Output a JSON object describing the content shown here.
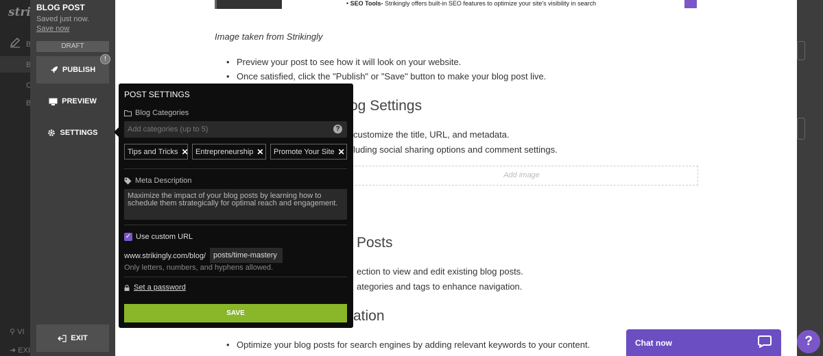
{
  "app": {
    "logo_text": "strik",
    "bg_letters": [
      "B",
      "B",
      "C",
      "B",
      "E"
    ],
    "bg_bottom": [
      "VI",
      "EXI"
    ]
  },
  "editor_sidebar": {
    "title": "BLOG POST",
    "saved_status": "Saved just now.",
    "save_now": "Save now",
    "draft_label": "DRAFT",
    "publish_label": "PUBLISH",
    "publish_badge": "!",
    "preview_label": "PREVIEW",
    "settings_label": "SETTINGS",
    "exit_label": "EXIT"
  },
  "page": {
    "seo_line_prefix": "SEO Tools-",
    "seo_line_rest": " Strikingly offers built-in SEO features to optimize your site's visibility in search",
    "caption": "Image taken from Strikingly",
    "bullets_1": [
      "Preview your post to see how it will look on your website.",
      "Once satisfied, click the \"Publish\" or \"Save\" button to make your blog post live."
    ],
    "heading_settings": "og Settings",
    "bullets_2": [
      "customize the title, URL, and metadata.",
      "luding social sharing options and comment settings."
    ],
    "add_image": "Add image",
    "heading_posts": "Posts",
    "bullets_3": [
      "ection to view and edit existing blog posts.",
      "ategories and tags to enhance navigation."
    ],
    "heading_ation": "ation",
    "bullet_4": "Optimize your blog posts for search engines by adding relevant keywords to your content."
  },
  "post_settings": {
    "title": "POST SETTINGS",
    "categories_label": "Blog Categories",
    "categories_placeholder": "Add categories (up to 5)",
    "help_glyph": "?",
    "tags": [
      "Tips and Tricks",
      "Entrepreneurship",
      "Promote Your Site"
    ],
    "meta_label": "Meta Description",
    "meta_value": "Maximize the impact of your blog posts by learning how to schedule them strategically for optimal reach and engagement.",
    "custom_url_label": "Use custom URL",
    "custom_url_checked": true,
    "url_prefix": "www.strikingly.com/blog/",
    "url_slug": "posts/time-mastery",
    "url_hint": "Only letters, numbers, and hyphens allowed.",
    "password_link": "Set a password",
    "save_label": "SAVE"
  },
  "chat": {
    "label": "Chat now",
    "help_glyph": "?"
  },
  "colors": {
    "accent_purple": "#7b56c9",
    "save_green": "#8ab72a",
    "popover_bg": "#0e0e0e"
  }
}
